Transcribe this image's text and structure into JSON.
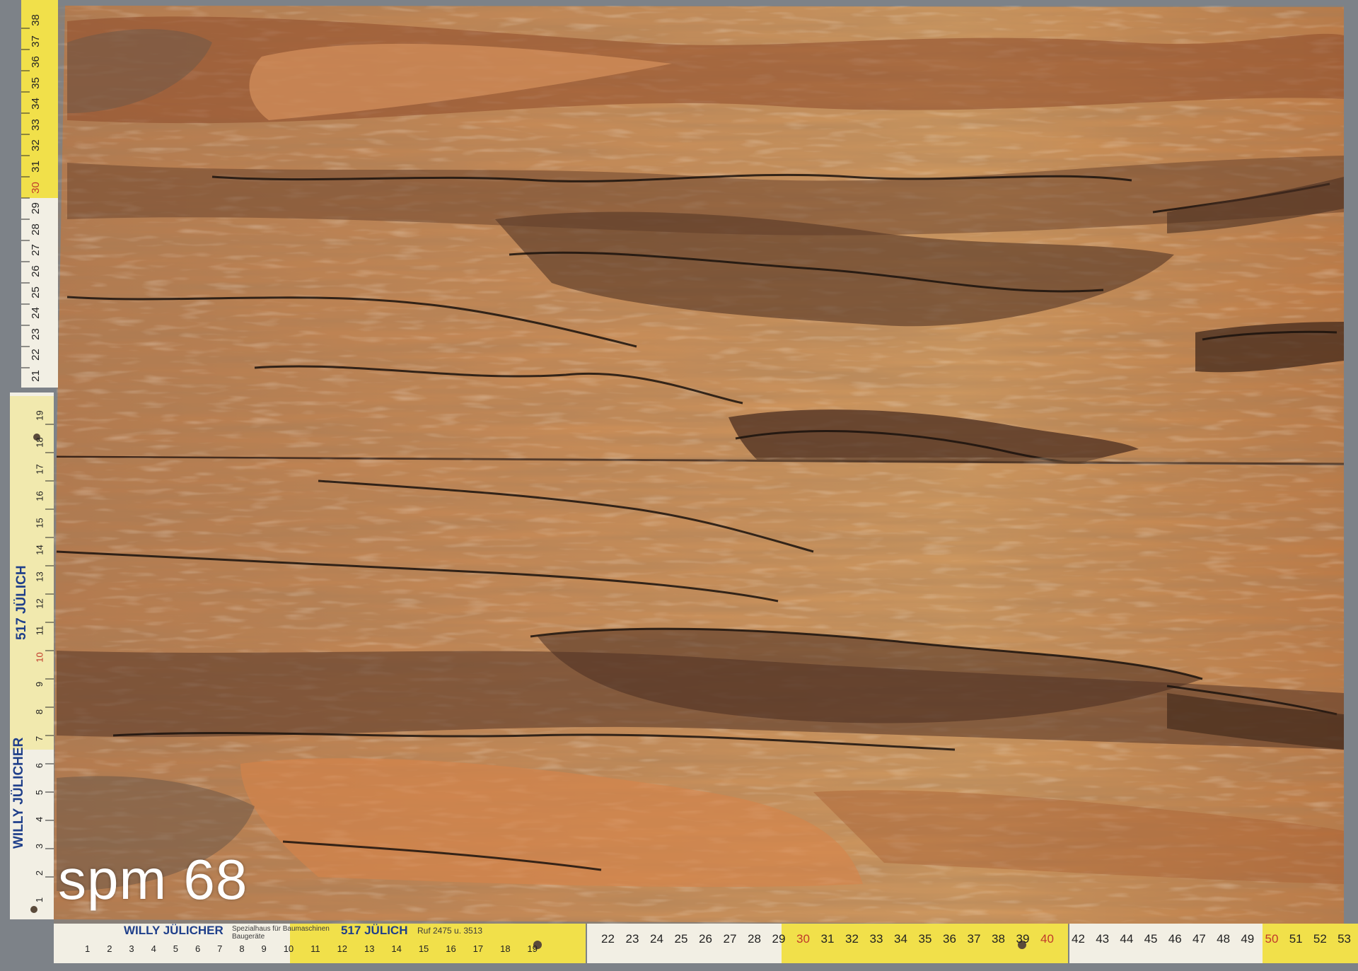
{
  "sample_label": "spm 68",
  "ruler_left": {
    "brand": "WILLY JÜLICHER",
    "phone": "517 JÜLICH",
    "ticks_top": [
      "21",
      "22",
      "23",
      "24",
      "25",
      "26",
      "27",
      "28",
      "29",
      "30",
      "31",
      "32",
      "33",
      "34",
      "35",
      "36",
      "37",
      "38"
    ],
    "ticks_bottom": [
      "1",
      "2",
      "3",
      "4",
      "5",
      "6",
      "7",
      "8",
      "9",
      "10",
      "11",
      "12",
      "13",
      "14",
      "15",
      "16",
      "17",
      "18",
      "19"
    ]
  },
  "ruler_bottom": {
    "brand": "WILLY JÜLICHER",
    "subtitle": "Spezialhaus für Baumaschinen Baugeräte",
    "phone": "517 JÜLICH",
    "ruf": "Ruf 2475 u. 3513",
    "ticks_a": [
      "1",
      "2",
      "3",
      "4",
      "5",
      "6",
      "7",
      "8",
      "9",
      "10",
      "11",
      "12",
      "13",
      "14",
      "15",
      "16",
      "17",
      "18",
      "19"
    ],
    "ticks_b": [
      "22",
      "23",
      "24",
      "25",
      "26",
      "27",
      "28",
      "29",
      "30",
      "31",
      "32",
      "33",
      "34",
      "35",
      "36",
      "37",
      "38",
      "39",
      "40"
    ],
    "ticks_c": [
      "42",
      "43",
      "44",
      "45",
      "46",
      "47",
      "48",
      "49",
      "50",
      "51",
      "52",
      "53"
    ]
  },
  "colors": {
    "wood_light": "#d6955a",
    "wood_mid": "#b06a3a",
    "wood_dark": "#5e3a26",
    "spalt_line": "#1a120d",
    "ruler_yellow": "#f1e04a",
    "ruler_white": "#f2efe4",
    "background": "#7d8288"
  }
}
